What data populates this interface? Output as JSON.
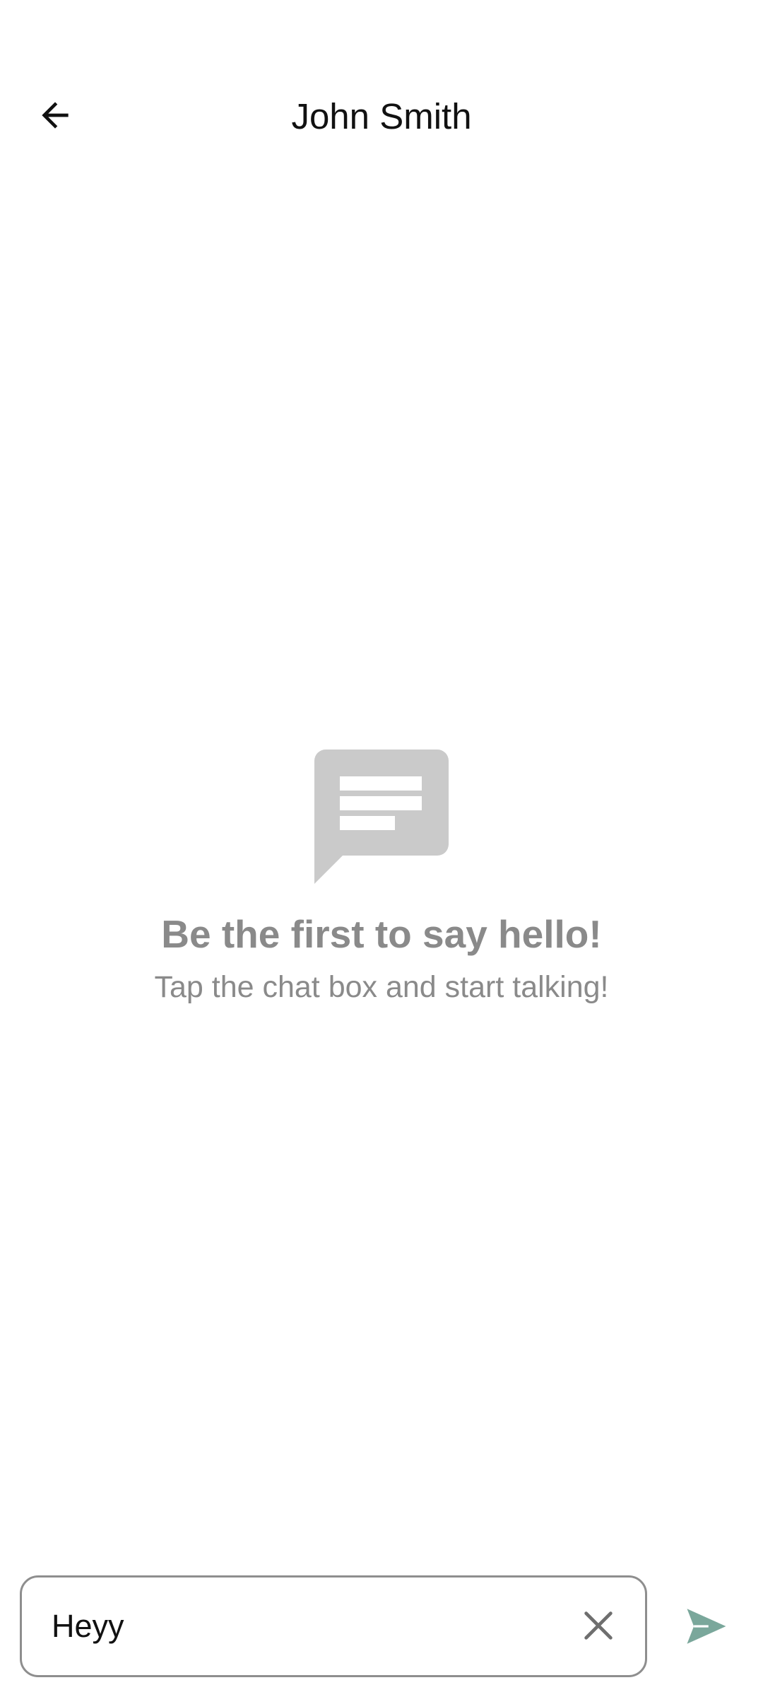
{
  "header": {
    "title": "John Smith",
    "back_icon": "arrow-back-icon"
  },
  "empty_state": {
    "icon": "chat-bubble-icon",
    "heading": "Be the first to say hello!",
    "subtext": "Tap the chat box and start talking!"
  },
  "composer": {
    "value": "Heyy",
    "clear_icon": "close-icon",
    "send_icon": "send-icon"
  },
  "colors": {
    "accent": "#7aa79b",
    "muted_text": "#8a8a8a",
    "icon_gray": "#cacaca",
    "border": "#8e8e8e"
  }
}
